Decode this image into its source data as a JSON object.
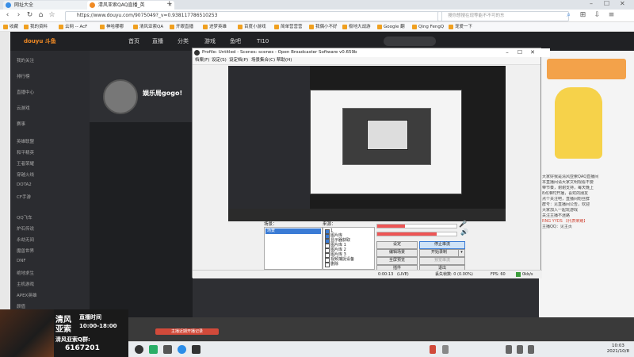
{
  "browser": {
    "tabs": [
      {
        "label": "网址大全"
      },
      {
        "label": "清风亚索QAQ直播_英"
      }
    ],
    "url": "https://www.douyu.com/9075049?_v=0.938117786510253",
    "search_placeholder": "搜你想搜在现等能不不可的东",
    "bookmarks": [
      "收藏",
      "我的资料",
      "云网 -- AcF",
      "神哈哪哪",
      "清风亚索QA",
      "开眼直播",
      "进梦英雄",
      "百度小游戏",
      "简单营营营",
      "我偶小不好",
      "极地大战游",
      "Google 翻",
      "Qing FengQ",
      "宠爱一下"
    ]
  },
  "site": {
    "logo": "douyu 斗鱼",
    "nav": [
      "首页",
      "直播",
      "分类",
      "游戏",
      "鱼吧",
      "TI10"
    ],
    "sidebar_items": [
      "我的关注",
      "排行榜",
      "直播中心",
      "云游戏",
      "赛事",
      "英雄联盟",
      "和平精英",
      "王者荣耀",
      "穿越火线",
      "DOTA2",
      "CF手游",
      "QQ飞车",
      "炉石传说",
      "永劫无间",
      "魔兽世界",
      "DNF",
      "绝地求生",
      "主机游戏",
      "APEX英雄",
      "颜值",
      "户外",
      "二次元"
    ],
    "room_title": "娱乐局gogo!",
    "right_panel_text": [
      "大家好我是清风亚索QAQ直播间",
      "本直播间请大家文明观看不要",
      "带节奏，谢谢支持，每天晚上",
      "8点准时开播，喜欢的朋友",
      "点个关注吧，直播间粉丝群",
      "群号：见直播间公告，欢迎",
      "大家加入一起玩游戏",
      "关注主播不迷路",
      "RNG YYDS 【代表荣耀】",
      "主播QQ：见主页"
    ],
    "gift_label": "主播近期开播记录"
  },
  "overlay": {
    "name_line1": "清风",
    "name_line2": "亚索",
    "schedule_label": "直播时间",
    "schedule_time": "10:00-18:00",
    "group_label": "清风亚索Q群:",
    "group_number": "6167201"
  },
  "obs": {
    "title": "Profile: Untitled - Scenes: scenes - Open Broadcaster Software v0.659b",
    "menu": [
      "档案(F)",
      "设定(S)",
      "设定档(P)",
      "场景集合(C)",
      "帮助(H)"
    ],
    "scenes_label": "场景：",
    "scenes": [
      "场景"
    ],
    "sources_label": "来源：",
    "sources": [
      {
        "label": "1",
        "checked": true
      },
      {
        "label": "图片库",
        "checked": true
      },
      {
        "label": "显示器获取",
        "checked": true
      },
      {
        "label": "图片库 1",
        "checked": false
      },
      {
        "label": "图片库 2",
        "checked": false
      },
      {
        "label": "图片库 3",
        "checked": false
      },
      {
        "label": "视频捕捉设备",
        "checked": false
      },
      {
        "label": "删除",
        "checked": false
      }
    ],
    "mic_volume": 0.35,
    "desktop_volume": 0.75,
    "buttons": {
      "settings": "设定",
      "stop_stream": "停止串流",
      "edit_scene": "编辑场景",
      "start_record": "开始录制",
      "fullscreen_preview": "全屏预览",
      "preview_stream": "预览串流",
      "plugins": "插件",
      "exit": "退出"
    },
    "status": {
      "time": "0:00:13",
      "live": "(LIVE)",
      "dropped": "丢失帧数: 0 (0.00%)",
      "fps": "FPS: 60",
      "bitrate": "0kb/s"
    }
  },
  "taskbar": {
    "time": "10:03",
    "date": "2021/10/8"
  },
  "colors": {
    "accent": "#f08a24",
    "obs_select": "#3a7bd5",
    "record_red": "#d14a3a"
  }
}
